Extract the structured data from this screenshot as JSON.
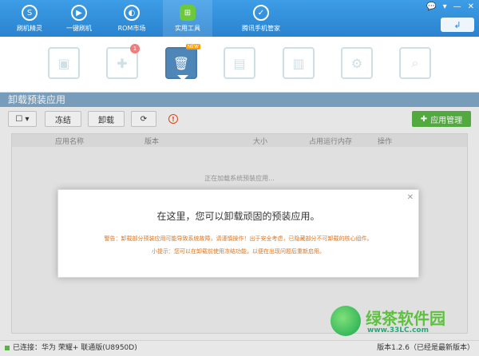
{
  "nav": {
    "items": [
      {
        "label": "刷机精灵",
        "icon": "logo-icon"
      },
      {
        "label": "一键刷机",
        "icon": "play-icon"
      },
      {
        "label": "ROM市场",
        "icon": "android-icon"
      },
      {
        "label": "实用工具",
        "icon": "grid-icon",
        "active": true
      },
      {
        "label": "腾讯手机管家",
        "icon": "shield-icon"
      }
    ],
    "window_controls": [
      "💬",
      "▾",
      "—",
      "✕"
    ],
    "back_glyph": "↲"
  },
  "tools": [
    {
      "name": "bag-icon",
      "glyph": "▣"
    },
    {
      "name": "puzzle-icon",
      "glyph": "✚",
      "badge": "1"
    },
    {
      "name": "trash-icon",
      "glyph": "🗑",
      "active": true,
      "tag": "NEW"
    },
    {
      "name": "doc-icon",
      "glyph": "▤"
    },
    {
      "name": "doc-edit-icon",
      "glyph": "▥"
    },
    {
      "name": "settings-doc-icon",
      "glyph": "⚙"
    },
    {
      "name": "search-doc-icon",
      "glyph": "⌕"
    }
  ],
  "section": {
    "title": "卸载预装应用"
  },
  "toolbar": {
    "select_glyph": "☐ ▾",
    "freeze_label": "冻结",
    "uninstall_label": "卸载",
    "refresh_glyph": "⟳",
    "warn_glyph": "!",
    "app_manage_label": "应用管理"
  },
  "table": {
    "columns": [
      "应用名称",
      "版本",
      "大小",
      "占用运行内存",
      "操作"
    ],
    "loading_text": "正在加载系统预装应用..."
  },
  "dialog": {
    "title": "在这里，您可以卸载顽固的预装应用。",
    "warning": "警告：卸载部分预装应用可能导致系统故障，请谨慎操作！出于安全考虑，已隐藏部分不可卸载的核心组件。",
    "tip": "小提示：您可以在卸载前使用冻结功能，以便在出现问题后重新启用。",
    "close_glyph": "✕"
  },
  "status": {
    "connected": "已连接：华为 荣耀+ 联通版(U8950D)",
    "version": "版本1.2.6（已经是最新版本）"
  },
  "watermark": {
    "cn": "绿茶软件园",
    "url": "www.33LC.com"
  },
  "colors": {
    "nav_blue": "#2a83cf",
    "accent_green": "#56b344",
    "warning_orange": "#e0741b"
  }
}
